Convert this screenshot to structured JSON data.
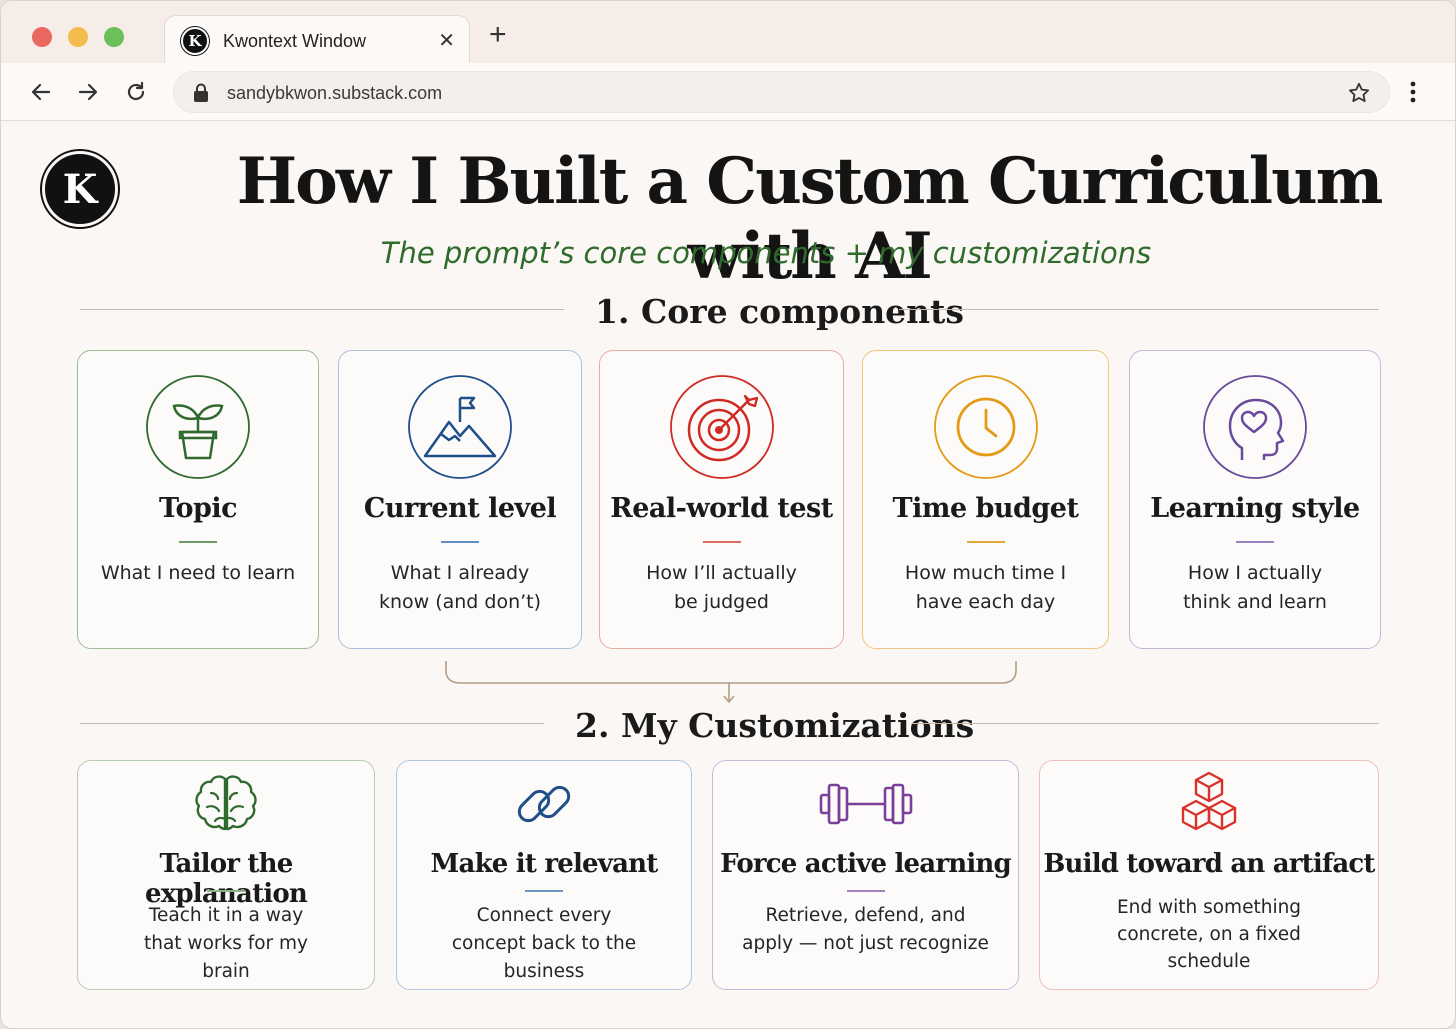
{
  "browser": {
    "tab_title": "Kwontext Window",
    "tab_favicon_letter": "K",
    "tab_close": "✕",
    "new_tab": "+",
    "url": "sandybkwon.substack.com"
  },
  "page": {
    "logo_letter": "K",
    "title": "How I Built a Custom Curriculum with AI",
    "subtitle": "The prompt’s core components + my customizations"
  },
  "core": {
    "heading": "1. Core components",
    "cards": [
      {
        "title": "Topic",
        "desc": "What I need to learn",
        "icon": "plant-icon",
        "color": "#2f6b2f"
      },
      {
        "title": "Current level",
        "desc": "What I already know (and don’t)",
        "icon": "mountain-flag-icon",
        "color": "#1f4f8a"
      },
      {
        "title": "Real-world test",
        "desc": "How I’ll actually be judged",
        "icon": "target-icon",
        "color": "#cf2a24"
      },
      {
        "title": "Time budget",
        "desc": "How much time I have each day",
        "icon": "clock-icon",
        "color": "#e49a17"
      },
      {
        "title": "Learning style",
        "desc": "How I actually think and learn",
        "icon": "head-heart-icon",
        "color": "#6a4a9a"
      }
    ]
  },
  "custom": {
    "heading": "2. My Customizations",
    "cards": [
      {
        "title": "Tailor the explanation",
        "desc": "Teach it in a way that works for my brain",
        "icon": "brain-icon",
        "color": "#2f6b2f"
      },
      {
        "title": "Make it relevant",
        "desc": "Connect every concept back to the business",
        "icon": "link-icon",
        "color": "#1f4f8a"
      },
      {
        "title": "Force active learning",
        "desc": "Retrieve, defend, and apply — not just recognize",
        "icon": "dumbbell-icon",
        "color": "#7a3f9a"
      },
      {
        "title": "Build toward an artifact",
        "desc": "End with something concrete, on a fixed schedule",
        "icon": "blocks-icon",
        "color": "#d9322a"
      }
    ]
  }
}
